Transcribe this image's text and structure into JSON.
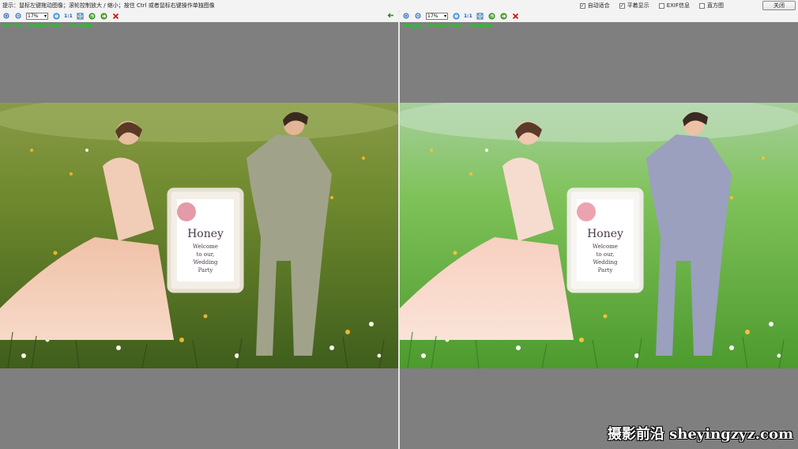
{
  "topbar": {
    "hint": "提示：鼠标左键拖动图像；滚轮控制放大 / 缩小；按住 Ctrl 或者鼠标右键操作单独图像",
    "options": [
      {
        "label": "自动适合",
        "checked": true
      },
      {
        "label": "平着显示",
        "checked": true
      },
      {
        "label": "EXIF信息",
        "checked": false
      },
      {
        "label": "直方图",
        "checked": false
      }
    ],
    "close_label": "关闭"
  },
  "toolbar": {
    "zoom_value": "17%",
    "ratio_label": "1:1",
    "icons": [
      "zoom-in-icon",
      "zoom-out-icon",
      "zoom-select",
      "fit-icon",
      "actual-size-icon",
      "fullscreen-icon",
      "rotate-left-icon",
      "rotate-right-icon",
      "delete-icon"
    ]
  },
  "panes": {
    "left": {
      "info": "17.cr2 ,  5760x3840 ,  27.0MB"
    },
    "right": {
      "info": "18.jpg ,  5760x3840 ,  13.0MB"
    }
  },
  "photo": {
    "sign_title": "Honey",
    "sign_line1": "Welcome",
    "sign_line2": "to our,",
    "sign_line3": "Wedding",
    "sign_line4": "Party"
  },
  "watermark": "摄影前沿 sheyingzyz.com",
  "colors": {
    "pane_bg": "#7f7f7f",
    "info_text": "#22c42a",
    "close_icon": "#d01010"
  }
}
